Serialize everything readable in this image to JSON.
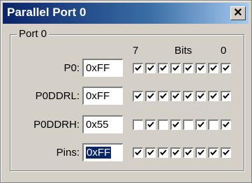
{
  "window": {
    "title": "Parallel Port 0"
  },
  "group": {
    "label": "Port 0"
  },
  "bits_header": {
    "high": "7",
    "label": "Bits",
    "low": "0"
  },
  "rows": [
    {
      "id": "p0",
      "label": "P0:",
      "value": "0xFF",
      "bits": [
        1,
        1,
        1,
        1,
        1,
        1,
        1,
        1
      ],
      "selected": false
    },
    {
      "id": "p0ddrl",
      "label": "P0DDRL:",
      "value": "0xFF",
      "bits": [
        1,
        1,
        1,
        1,
        1,
        1,
        1,
        1
      ],
      "selected": false
    },
    {
      "id": "p0ddrh",
      "label": "P0DDRH:",
      "value": "0x55",
      "bits": [
        0,
        1,
        0,
        1,
        0,
        1,
        0,
        1
      ],
      "selected": false
    },
    {
      "id": "pins",
      "label": "Pins:",
      "value": "0xFF",
      "bits": [
        1,
        1,
        1,
        1,
        1,
        1,
        1,
        1
      ],
      "selected": true
    }
  ]
}
